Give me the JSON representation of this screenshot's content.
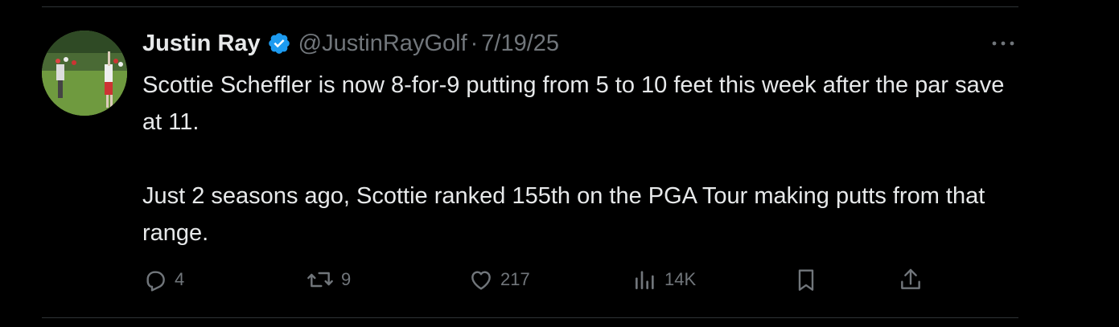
{
  "tweet": {
    "author": {
      "display_name": "Justin Ray",
      "handle": "@JustinRayGolf",
      "verified": true
    },
    "separator": "·",
    "date": "7/19/25",
    "text_paragraphs": [
      "Scottie Scheffler is now 8-for-9 putting from 5 to 10 feet this week after the par save at 11.",
      "Just 2 seasons ago, Scottie ranked 155th on the PGA Tour making putts from that range."
    ]
  },
  "actions": {
    "replies": "4",
    "reposts": "9",
    "likes": "217",
    "views": "14K"
  },
  "colors": {
    "background": "#000000",
    "primary_text": "#e7e9ea",
    "secondary_text": "#71767b",
    "verified_badge": "#1d9bf0",
    "divider": "#2f3336"
  },
  "icons": {
    "verified": "verified-badge-icon",
    "more": "more-options-icon",
    "reply": "reply-icon",
    "repost": "repost-icon",
    "like": "heart-icon",
    "views": "views-chart-icon",
    "bookmark": "bookmark-icon",
    "share": "share-icon"
  }
}
